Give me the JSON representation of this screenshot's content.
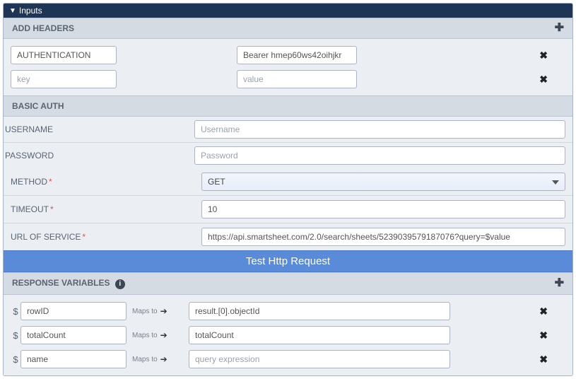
{
  "panel": {
    "title": "Inputs"
  },
  "headers": {
    "section_title": "ADD HEADERS",
    "add_icon": "plus-icon",
    "rows": [
      {
        "key": "AUTHENTICATION",
        "value": "Bearer hmep60ws42oihjkr",
        "key_placeholder": "key",
        "value_placeholder": "value"
      },
      {
        "key": "",
        "value": "",
        "key_placeholder": "key",
        "value_placeholder": "value"
      }
    ]
  },
  "basic_auth": {
    "section_title": "BASIC AUTH",
    "username_label": "USERNAME",
    "password_label": "PASSWORD",
    "username_value": "",
    "password_value": "",
    "username_placeholder": "Username",
    "password_placeholder": "Password"
  },
  "request": {
    "method_label": "METHOD",
    "method_value": "GET",
    "timeout_label": "TIMEOUT",
    "timeout_value": "10",
    "url_label": "URL OF SERVICE",
    "url_value": "https://api.smartsheet.com/2.0/search/sheets/5239039579187076?query=$value",
    "required_mark": "*"
  },
  "test_button": {
    "label": "Test Http Request"
  },
  "response": {
    "section_title": "RESPONSE VARIABLES",
    "info_icon": "info-icon",
    "add_icon": "plus-icon",
    "maps_to_label": "Maps to",
    "dollar": "$",
    "expr_placeholder": "query expression",
    "name_placeholder": "name",
    "rows": [
      {
        "name": "rowID",
        "expr": "result.[0].objectId"
      },
      {
        "name": "totalCount",
        "expr": "totalCount"
      },
      {
        "name": "name",
        "expr": ""
      }
    ]
  }
}
